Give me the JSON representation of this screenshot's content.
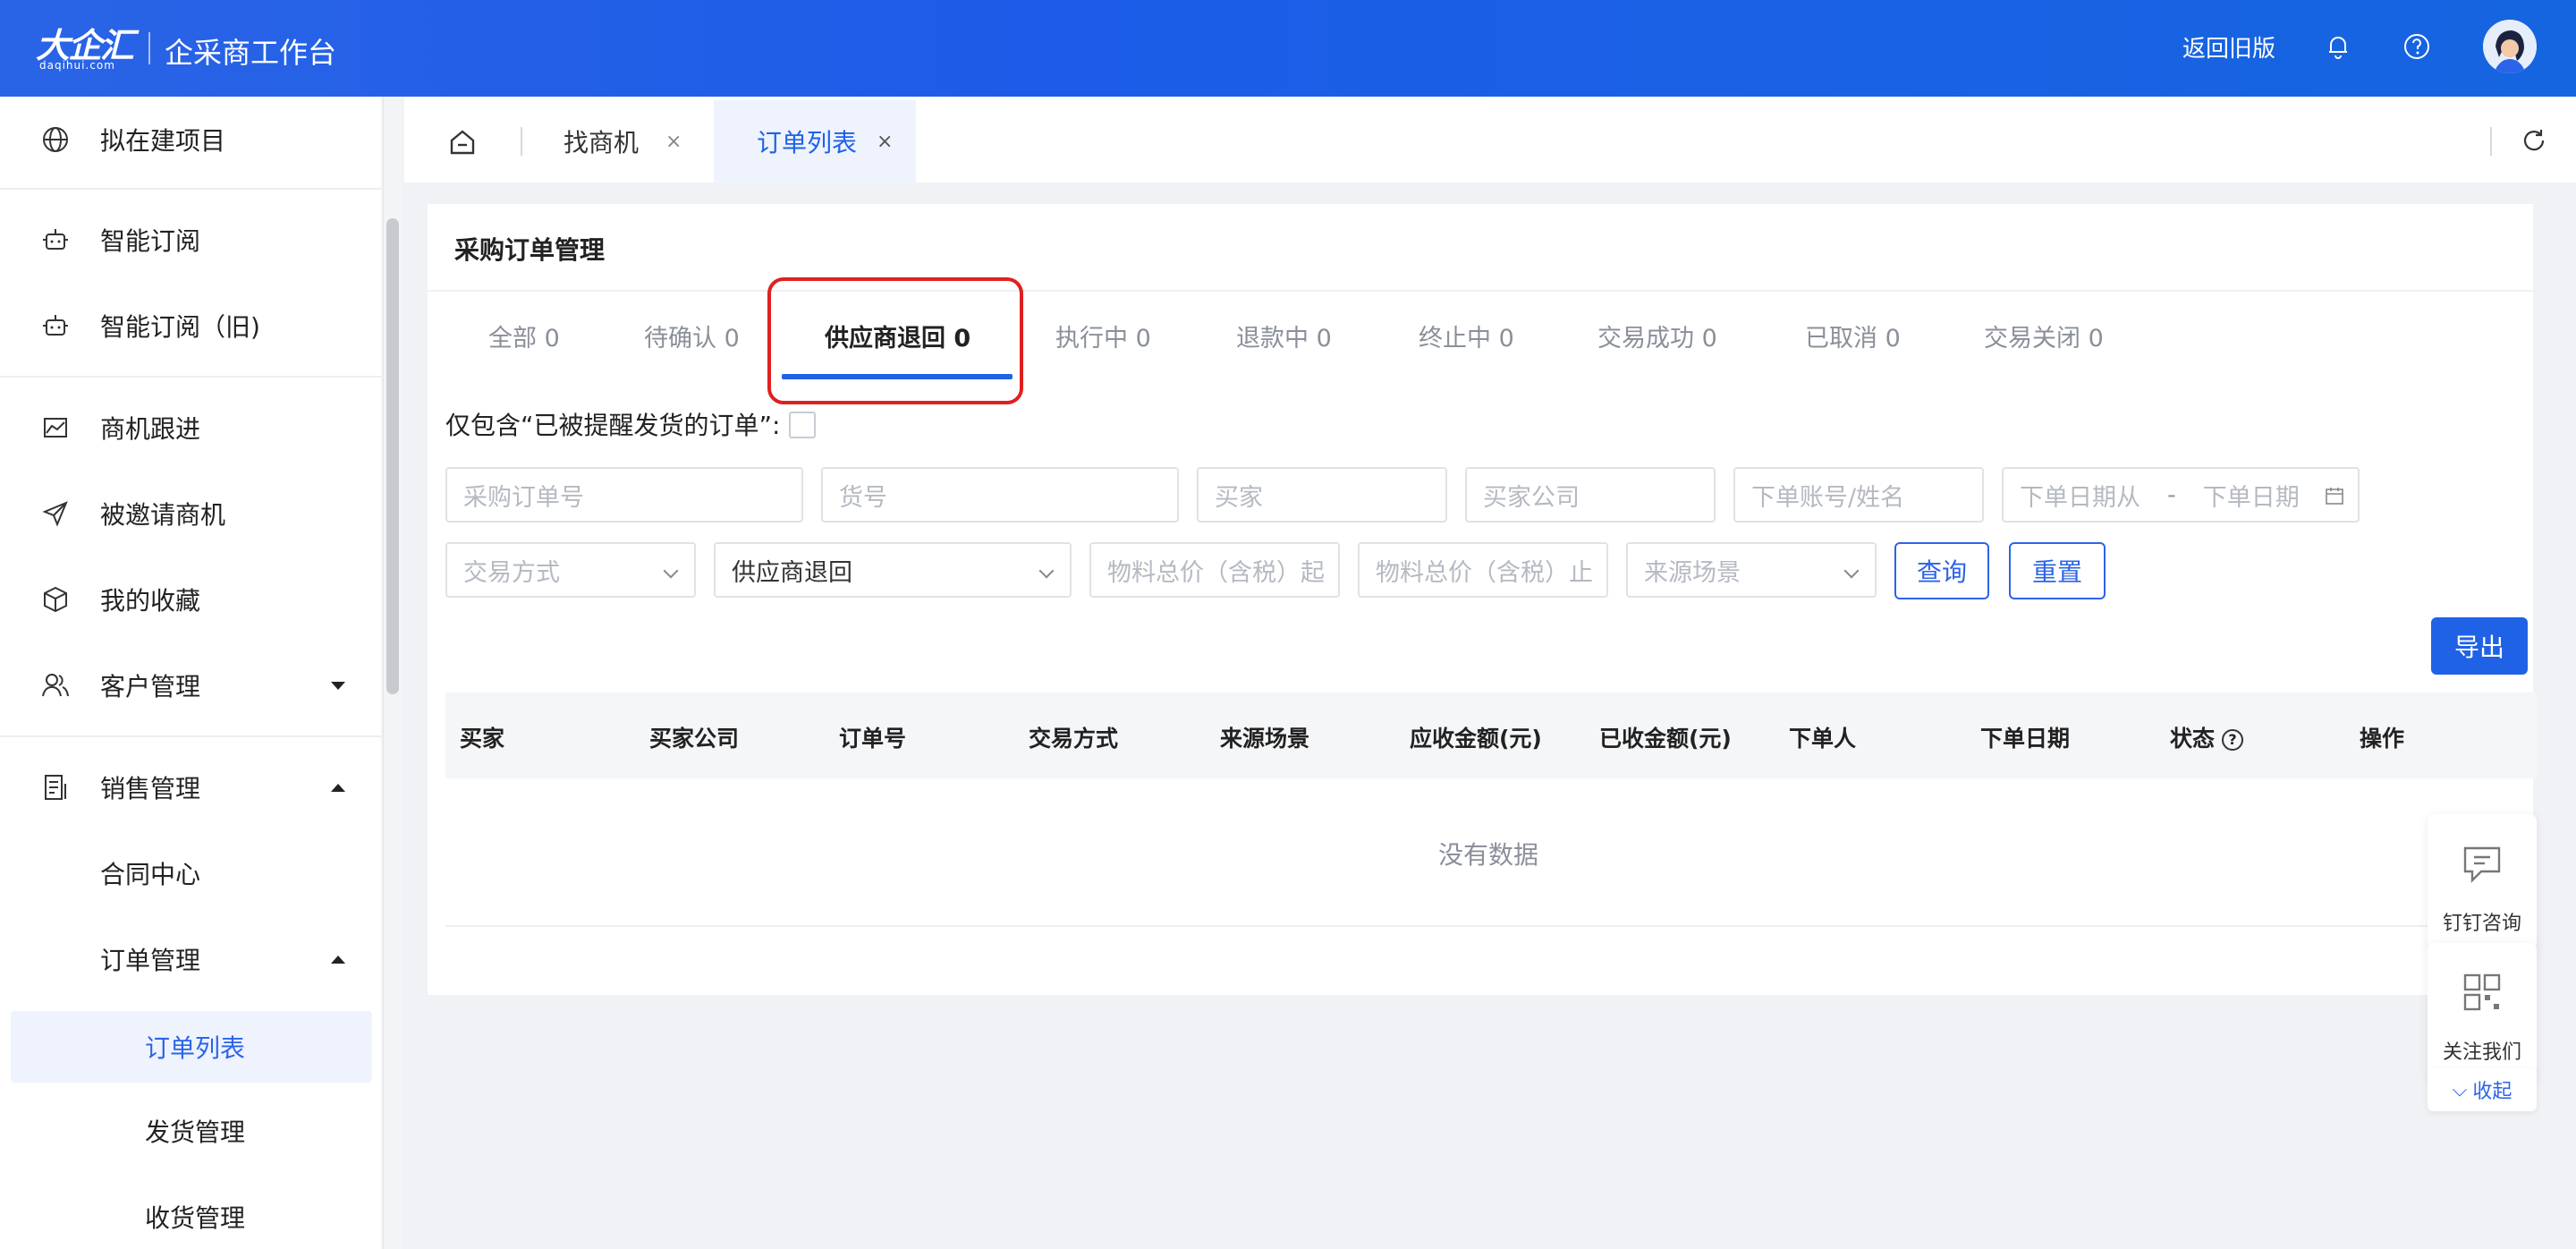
{
  "header": {
    "logo_main": "大企汇",
    "logo_sub": "daqihui.com",
    "app_title": "企采商工作台",
    "back_old": "返回旧版"
  },
  "sidebar": {
    "items": [
      {
        "label": "拟在建项目",
        "icon": "globe-icon"
      },
      {
        "label": "智能订阅",
        "icon": "robot-icon"
      },
      {
        "label": "智能订阅（旧)",
        "icon": "robot-icon"
      },
      {
        "label": "商机跟进",
        "icon": "chart-icon"
      },
      {
        "label": "被邀请商机",
        "icon": "send-icon"
      },
      {
        "label": "我的收藏",
        "icon": "box-icon"
      },
      {
        "label": "客户管理",
        "icon": "users-icon"
      },
      {
        "label": "销售管理",
        "icon": "document-icon"
      },
      {
        "label": "合同中心"
      },
      {
        "label": "订单管理"
      },
      {
        "label": "订单列表"
      },
      {
        "label": "发货管理"
      },
      {
        "label": "收货管理"
      }
    ]
  },
  "tabs": [
    {
      "label": "找商机",
      "close": "×"
    },
    {
      "label": "订单列表",
      "close": "×"
    }
  ],
  "panel": {
    "title": "采购订单管理",
    "status_tabs": [
      "全部 0",
      "待确认 0",
      "供应商退回 0",
      "执行中 0",
      "退款中 0",
      "终止中 0",
      "交易成功 0",
      "已取消 0",
      "交易关闭 0"
    ],
    "active_status": "供应商退回 0",
    "remind_label": "仅包含“已被提醒发货的订单”:",
    "filters": {
      "order_no": "采购订单号",
      "goods_no": "货号",
      "buyer": "买家",
      "buyer_company": "买家公司",
      "order_account": "下单账号/姓名",
      "date_from": "下单日期从",
      "date_sep": "-",
      "date_to": "下单日期",
      "trade_method": "交易方式",
      "status_value": "供应商退回",
      "amount_from": "物料总价（含税）起",
      "amount_to": "物料总价（含税）止",
      "source": "来源场景"
    },
    "buttons": {
      "query": "查询",
      "reset": "重置",
      "export": "导出"
    },
    "table": {
      "columns": [
        "买家",
        "买家公司",
        "订单号",
        "交易方式",
        "来源场景",
        "应收金额(元)",
        "已收金额(元)",
        "下单人",
        "下单日期",
        "状态",
        "操作"
      ],
      "empty": "没有数据"
    }
  },
  "float": {
    "dingtalk": "钉钉咨询",
    "follow": "关注我们",
    "collapse": "收起"
  }
}
